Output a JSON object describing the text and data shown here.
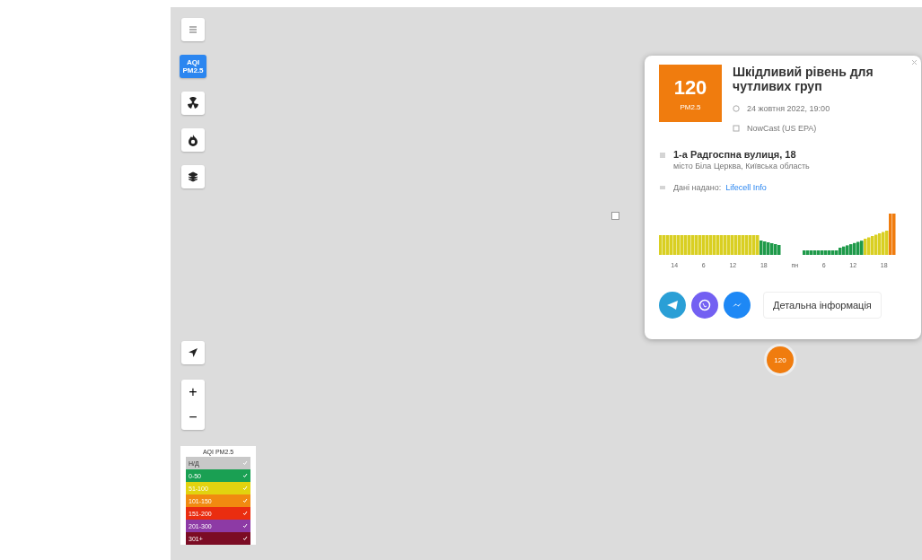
{
  "map_controls": [
    {
      "kind": "menu",
      "selected": false
    },
    {
      "kind": "aqi",
      "selected": true,
      "label": "AQI",
      "sublabel": "PM2.5"
    },
    {
      "kind": "radiation",
      "selected": false
    },
    {
      "kind": "fire",
      "selected": false
    },
    {
      "kind": "layers",
      "selected": false
    }
  ],
  "zoom": {
    "plus": "+",
    "minus": "−"
  },
  "legend": {
    "title": "AQI PM2.5",
    "rows": [
      {
        "label": "Н/Д",
        "color": "#c8c8c8",
        "checked": true
      },
      {
        "label": "0-50",
        "color": "#1aa053",
        "checked": true
      },
      {
        "label": "51-100",
        "color": "#e2d30f",
        "checked": true
      },
      {
        "label": "101-150",
        "color": "#f18a10",
        "checked": true
      },
      {
        "label": "151-200",
        "color": "#ea2d10",
        "checked": true
      },
      {
        "label": "201-300",
        "color": "#8d3aa5",
        "checked": true
      },
      {
        "label": "301+",
        "color": "#7b0c24",
        "checked": true
      }
    ]
  },
  "popup": {
    "aqi": "120",
    "aqi_label": "PM2.5",
    "color": "#f07c0e",
    "title": "Шкідливий рівень для чутливих груп",
    "time": "24 жовтня 2022, 19:00",
    "method": "NowCast (US EPA)",
    "address": "1-а Радгоспна вулиця, 18",
    "city": "місто Біла Церква, Київська область",
    "source_label": "Дані надано:",
    "source_link": "Lifecell Info",
    "chart_labels": [
      "14",
      "6",
      "12",
      "18",
      "пн",
      "6",
      "12",
      "18"
    ],
    "details_button": "Детальна інформація"
  },
  "marker": {
    "label": "120",
    "color": "#f07c0e"
  }
}
